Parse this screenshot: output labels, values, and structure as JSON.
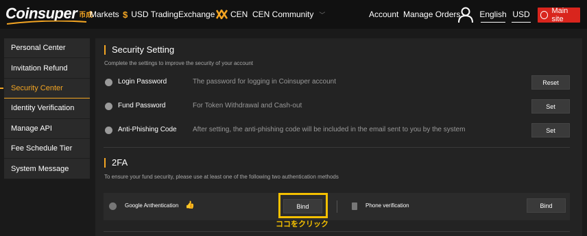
{
  "header": {
    "logo_text": "Coinsuper",
    "logo_cn": "币成",
    "nav": {
      "markets": "Markets",
      "usd_trading": "USD Trading",
      "usd_trading_icon": "$",
      "exchange": "Exchange",
      "cen": "CEN",
      "cen_community": "CEN Community"
    },
    "account": "Account",
    "manage_orders": "Manage Orders",
    "language": "English",
    "currency": "USD",
    "main_site": "Main site"
  },
  "sidebar": {
    "items": [
      {
        "label": "Personal Center"
      },
      {
        "label": "Invitation Refund"
      },
      {
        "label": "Security Center"
      },
      {
        "label": "Identity Verification"
      },
      {
        "label": "Manage API"
      },
      {
        "label": "Fee Schedule Tier"
      },
      {
        "label": "System Message"
      }
    ]
  },
  "security": {
    "title": "Security Setting",
    "desc": "Complete the settings to improve the security of your account",
    "rows": [
      {
        "label": "Login Password",
        "desc": "The password for logging in Coinsuper account",
        "action": "Reset",
        "icon": "lock-icon"
      },
      {
        "label": "Fund Password",
        "desc": "For Token Withdrawal and Cash-out",
        "action": "Set",
        "icon": "card-icon"
      },
      {
        "label": "Anti-Phishing Code",
        "desc": "After setting, the anti-phishing code will be included in the email sent to you by the system",
        "action": "Set",
        "icon": "shield-icon"
      }
    ]
  },
  "twofa": {
    "title": "2FA",
    "desc": "To ensure your fund security, please use at least one of the following two authentication methods",
    "google": {
      "label": "Google Anthentication",
      "action": "Bind"
    },
    "phone": {
      "label": "Phone verification",
      "action": "Bind"
    }
  },
  "annotation": "ココをクリック",
  "colors": {
    "accent": "#f5a623",
    "highlight": "#f5c000",
    "main_site": "#d9251d"
  }
}
